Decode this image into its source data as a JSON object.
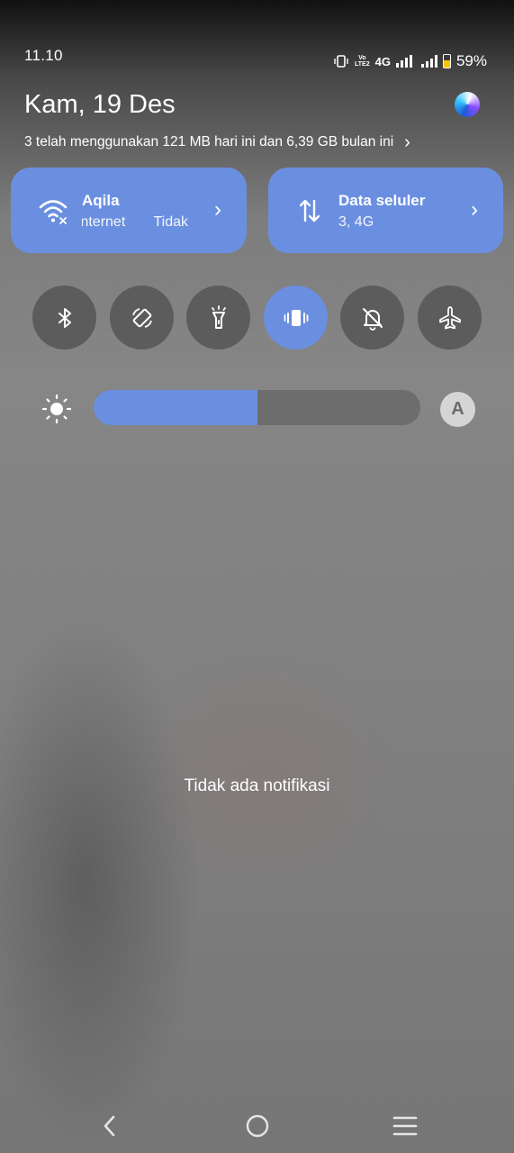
{
  "status_bar": {
    "time": "11.10",
    "volte_top": "Vo",
    "volte_bottom": "LTE2",
    "network": "4G",
    "battery_level": 0.59,
    "battery_text": "59%"
  },
  "header": {
    "date": "Kam, 19 Des",
    "usage_text": "3 telah menggunakan 121 MB hari ini dan 6,39 GB bulan ini"
  },
  "tiles": {
    "wifi": {
      "title": "Aqila",
      "subtitle_left": "Internet",
      "subtitle_right": "Tidak",
      "icon": "wifi-icon"
    },
    "mobile_data": {
      "title": "Data seluler",
      "subtitle": "3, 4G",
      "icon": "data-transfer-icon"
    }
  },
  "toggles": [
    {
      "name": "bluetooth",
      "active": false,
      "icon": "bluetooth-icon"
    },
    {
      "name": "auto-rotate",
      "active": false,
      "icon": "rotate-icon"
    },
    {
      "name": "flashlight",
      "active": false,
      "icon": "flashlight-icon"
    },
    {
      "name": "vibrate",
      "active": true,
      "icon": "vibrate-icon"
    },
    {
      "name": "do-not-disturb",
      "active": false,
      "icon": "bell-off-icon"
    },
    {
      "name": "airplane-mode",
      "active": false,
      "icon": "airplane-icon"
    }
  ],
  "brightness": {
    "level": 0.5,
    "auto_label": "A"
  },
  "notifications": {
    "empty_text": "Tidak ada notifikasi"
  },
  "colors": {
    "accent": "#6b8fe0",
    "toggle_off": "#5c5c5c",
    "battery": "#f5c400"
  }
}
